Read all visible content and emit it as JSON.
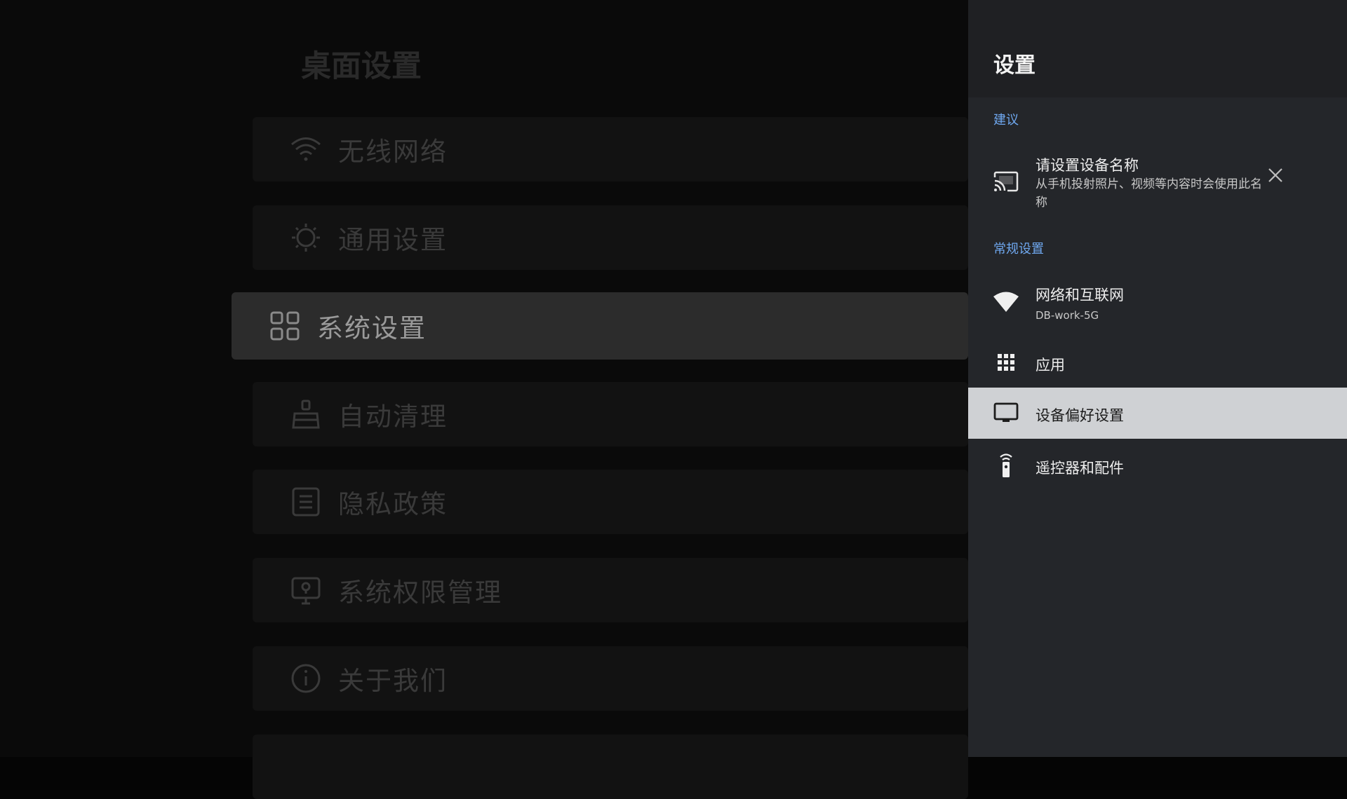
{
  "background": {
    "title": "桌面设置",
    "menu": [
      {
        "label": "无线网络",
        "icon": "wifi-icon"
      },
      {
        "label": "通用设置",
        "icon": "sun-icon"
      },
      {
        "label": "系统设置",
        "icon": "grid-icon",
        "active": true
      },
      {
        "label": "自动清理",
        "icon": "broom-icon"
      },
      {
        "label": "隐私政策",
        "icon": "document-icon"
      },
      {
        "label": "系统权限管理",
        "icon": "monitor-lock-icon"
      },
      {
        "label": "关于我们",
        "icon": "info-icon"
      }
    ]
  },
  "panel": {
    "title": "设置",
    "suggestions_label": "建议",
    "suggestion": {
      "title": "请设置设备名称",
      "subtitle": "从手机投射照片、视频等内容时会使用此名称",
      "icon": "cast-icon"
    },
    "general_label": "常规设置",
    "items": [
      {
        "title": "网络和互联网",
        "subtitle": "DB-work-5G",
        "icon": "wifi-filled-icon"
      },
      {
        "title": "应用",
        "icon": "apps-grid-icon"
      },
      {
        "title": "设备偏好设置",
        "icon": "tv-icon",
        "selected": true
      },
      {
        "title": "遥控器和配件",
        "icon": "remote-icon"
      }
    ]
  },
  "colors": {
    "accent": "#6fa8f0",
    "panel_bg": "#24262a",
    "selected_bg": "#cfd1d4"
  }
}
